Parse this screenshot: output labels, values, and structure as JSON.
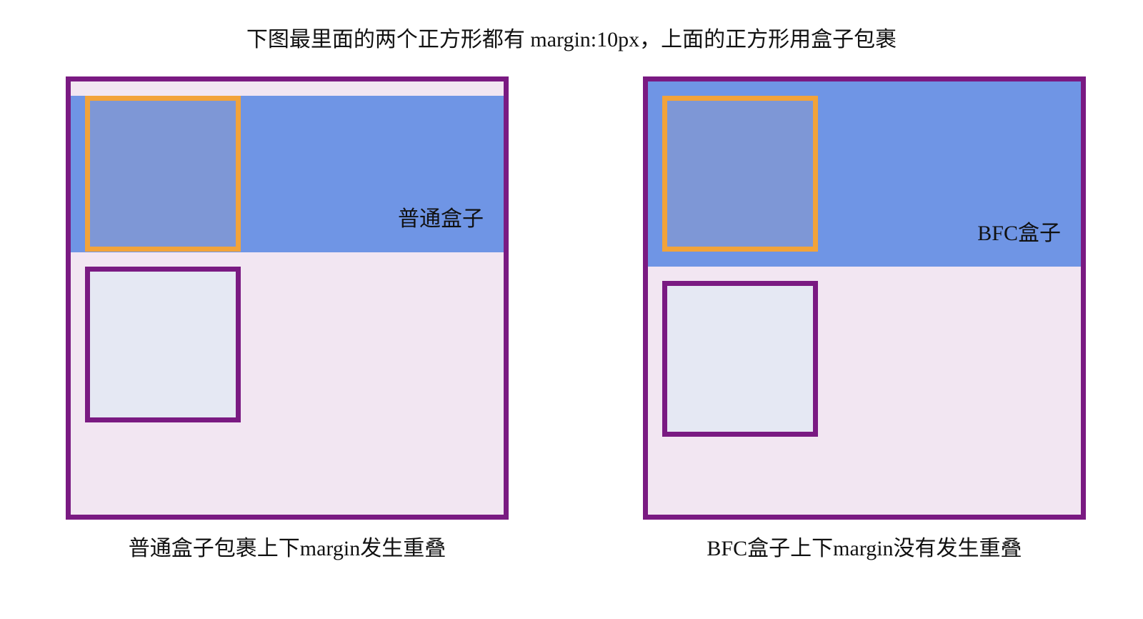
{
  "title": "下图最里面的两个正方形都有 margin:10px，上面的正方形用盒子包裹",
  "left_panel": {
    "box_label": "普通盒子",
    "caption": "普通盒子包裹上下margin发生重叠"
  },
  "right_panel": {
    "box_label": "BFC盒子",
    "caption": "BFC盒子上下margin没有发生重叠"
  },
  "colors": {
    "outer_border": "#7a1a82",
    "outer_fill": "#f2e6f2",
    "wrapper_fill": "#6f95e5",
    "top_square_border": "#f2a33a",
    "top_square_fill": "#7e97d6",
    "bottom_square_border": "#7a1a82",
    "bottom_square_fill": "#e5e8f3"
  }
}
